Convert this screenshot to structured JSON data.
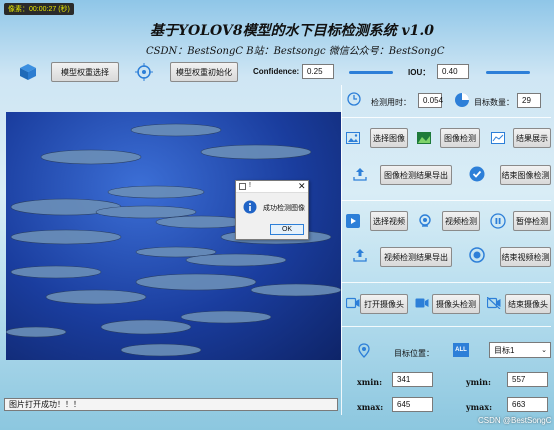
{
  "window": {
    "title_badge": "像素：",
    "timestamp": "00:00:27 (秒)"
  },
  "header": {
    "title": "基于YOLOV8模型的水下目标检测系统 v1.0",
    "subtitle": "CSDN：BestSongC   B站：Bestsongc   微信公众号：BestSongC"
  },
  "toolbar": {
    "model_select": "模型权重选择",
    "model_init": "模型权重初始化",
    "confidence_label": "Confidence:",
    "confidence_value": "0.25",
    "iou_label": "IOU：",
    "iou_value": "0.40"
  },
  "stats": {
    "time_label": "检测用时：",
    "time_value": "0.054",
    "count_label": "目标数量：",
    "count_value": "29"
  },
  "image_controls": {
    "select_image": "选择图像",
    "detect_image": "图像检测",
    "show_results": "结果展示",
    "export_image_results": "图像检测结果导出",
    "finish_image_detect": "结束图像检测"
  },
  "video_controls": {
    "select_video": "选择视频",
    "detect_video": "视频检测",
    "pause_detect": "暂停检测",
    "export_video_results": "视频检测结果导出",
    "finish_video_detect": "结束视频检测"
  },
  "camera_controls": {
    "open_camera": "打开摄像头",
    "camera_detect": "摄像头检测",
    "close_camera": "结束摄像头"
  },
  "target": {
    "position_label": "目标位置：",
    "all_badge": "ALL",
    "selected_target": "目标1",
    "xmin_label": "xmin:",
    "xmin_value": "341",
    "ymin_label": "ymin:",
    "ymin_value": "557",
    "xmax_label": "xmax:",
    "xmax_value": "645",
    "ymax_label": "ymax:",
    "ymax_value": "663"
  },
  "status": {
    "message": "图片打开成功！！！"
  },
  "dialog": {
    "title": "!",
    "message": "成功检测图像",
    "ok": "OK"
  },
  "watermark": "CSDN @BestSongC",
  "colors": {
    "accent": "#2d7fd8",
    "image_bg": "#1a3d9e"
  }
}
